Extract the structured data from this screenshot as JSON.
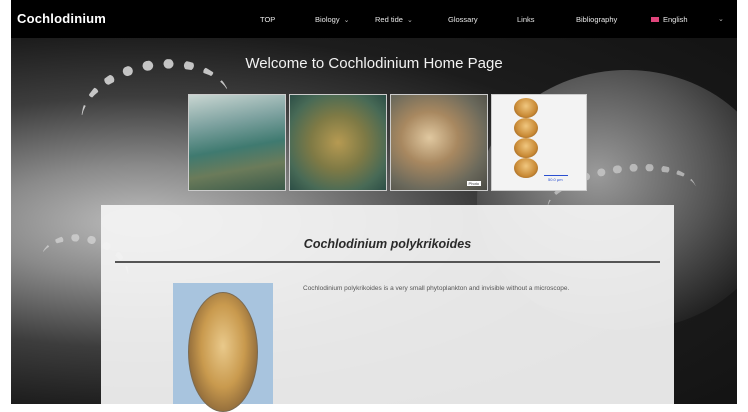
{
  "site": {
    "brand": "Cochlodinium"
  },
  "nav": {
    "items": [
      {
        "label": "TOP"
      },
      {
        "label": "Biology"
      },
      {
        "label": "Red tide"
      },
      {
        "label": "Glossary"
      },
      {
        "label": "Links"
      },
      {
        "label": "Bibliography"
      },
      {
        "label": "English"
      }
    ]
  },
  "hero": {
    "title": "Welcome to Cochlodinium Home Page"
  },
  "gallery": {
    "p3_caption": "Photo",
    "p4_scale_text": "50.0 µm"
  },
  "content": {
    "species_title": "Cochlodinium polykrikoides",
    "description": "Cochlodinium polykrikoides is a very small phytoplankton and invisible without a microscope."
  }
}
